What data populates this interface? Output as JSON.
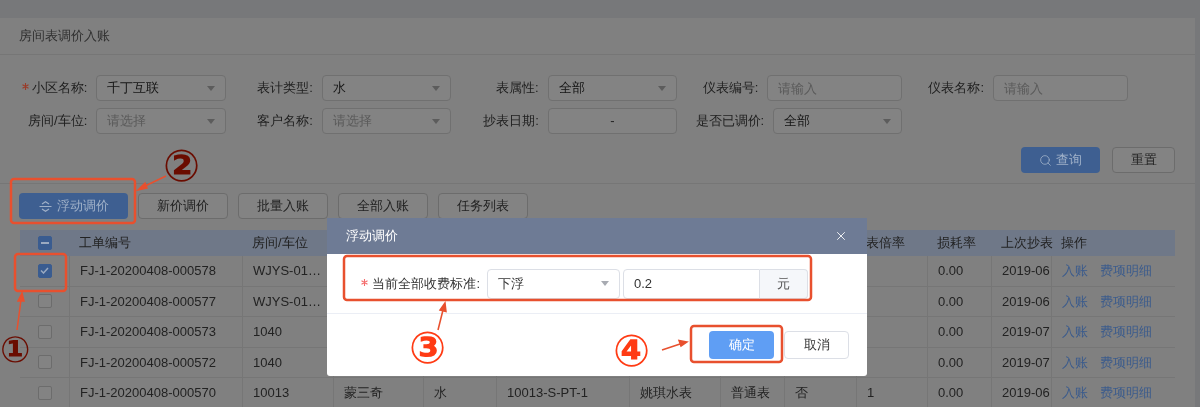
{
  "page_title": "房间表调价入账",
  "filters": [
    {
      "label": "小区名称:",
      "required": true,
      "kind": "select",
      "value": "千丁互联"
    },
    {
      "label": "表计类型:",
      "required": false,
      "kind": "select",
      "value": "水"
    },
    {
      "label": "表属性:",
      "required": false,
      "kind": "select",
      "value": "全部"
    },
    {
      "label": "仪表编号:",
      "required": false,
      "kind": "input",
      "placeholder": "请输入"
    },
    {
      "label": "仪表名称:",
      "required": false,
      "kind": "input",
      "placeholder": "请输入"
    },
    {
      "label": "房间/车位:",
      "required": false,
      "kind": "select",
      "placeholder": "请选择"
    },
    {
      "label": "客户名称:",
      "required": false,
      "kind": "select",
      "placeholder": "请选择"
    },
    {
      "label": "抄表日期:",
      "required": false,
      "kind": "date_range",
      "separator": "-"
    },
    {
      "label": "是否已调价:",
      "required": false,
      "kind": "select",
      "value": "全部"
    }
  ],
  "search_buttons": [
    {
      "label": "查询",
      "kind": "primary"
    },
    {
      "label": "重置",
      "kind": "default"
    }
  ],
  "actions": [
    {
      "label": "浮动调价",
      "kind": "primary"
    },
    {
      "label": "新价调价",
      "kind": "default"
    },
    {
      "label": "批量入账",
      "kind": "default"
    },
    {
      "label": "全部入账",
      "kind": "default"
    },
    {
      "label": "任务列表",
      "kind": "default"
    }
  ],
  "table": {
    "header_checked": true,
    "columns": [
      "工单编号",
      "房间/车位",
      null,
      null,
      null,
      null,
      null,
      null,
      "表倍率",
      "损耗率",
      "上次抄表",
      "操作"
    ],
    "rows": [
      {
        "checked": true,
        "cells": [
          "FJ-1-20200408-000578",
          "WJYS-01…",
          null,
          null,
          null,
          null,
          null,
          null,
          null,
          "0.00",
          "2019-06"
        ],
        "links": [
          "入账",
          "费项明细"
        ]
      },
      {
        "checked": false,
        "cells": [
          "FJ-1-20200408-000577",
          "WJYS-01…",
          null,
          null,
          null,
          null,
          null,
          null,
          null,
          "0.00",
          "2019-06"
        ],
        "links": [
          "入账",
          "费项明细"
        ]
      },
      {
        "checked": false,
        "cells": [
          "FJ-1-20200408-000573",
          "1040",
          null,
          null,
          null,
          null,
          null,
          null,
          null,
          "0.00",
          "2019-07"
        ],
        "links": [
          "入账",
          "费项明细"
        ]
      },
      {
        "checked": false,
        "cells": [
          "FJ-1-20200408-000572",
          "1040",
          null,
          null,
          null,
          null,
          null,
          null,
          null,
          "0.00",
          "2019-07"
        ],
        "links": [
          "入账",
          "费项明细"
        ]
      },
      {
        "checked": false,
        "cells": [
          "FJ-1-20200408-000570",
          "10013",
          "蒙三奇",
          "水",
          "10013-S-PT-1",
          "姚琪水表",
          "普通表",
          "否",
          "1",
          "0.00",
          "2019-06"
        ],
        "links": [
          "入账",
          "费项明细"
        ]
      }
    ]
  },
  "modal": {
    "title": "浮动调价",
    "field": {
      "label": "当前全部收费标准:",
      "required": true,
      "select": "下浮",
      "value": "0.2",
      "unit": "元"
    },
    "buttons": [
      {
        "label": "确定",
        "kind": "primary"
      },
      {
        "label": "取消",
        "kind": "default"
      }
    ]
  },
  "annotations": [
    {
      "label": "①"
    },
    {
      "label": "②"
    },
    {
      "label": "③"
    },
    {
      "label": "④"
    }
  ]
}
